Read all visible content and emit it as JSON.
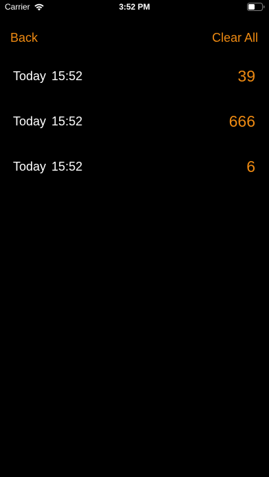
{
  "status_bar": {
    "carrier": "Carrier",
    "time": "3:52 PM",
    "wifi_icon": "wifi-icon",
    "battery_icon": "battery-icon"
  },
  "nav": {
    "back_label": "Back",
    "clear_label": "Clear All"
  },
  "history": [
    {
      "day": "Today",
      "time": "15:52",
      "value": "39"
    },
    {
      "day": "Today",
      "time": "15:52",
      "value": "666"
    },
    {
      "day": "Today",
      "time": "15:52",
      "value": "6"
    }
  ],
  "colors": {
    "accent": "#ee8a12",
    "background": "#000000",
    "text": "#ffffff"
  }
}
